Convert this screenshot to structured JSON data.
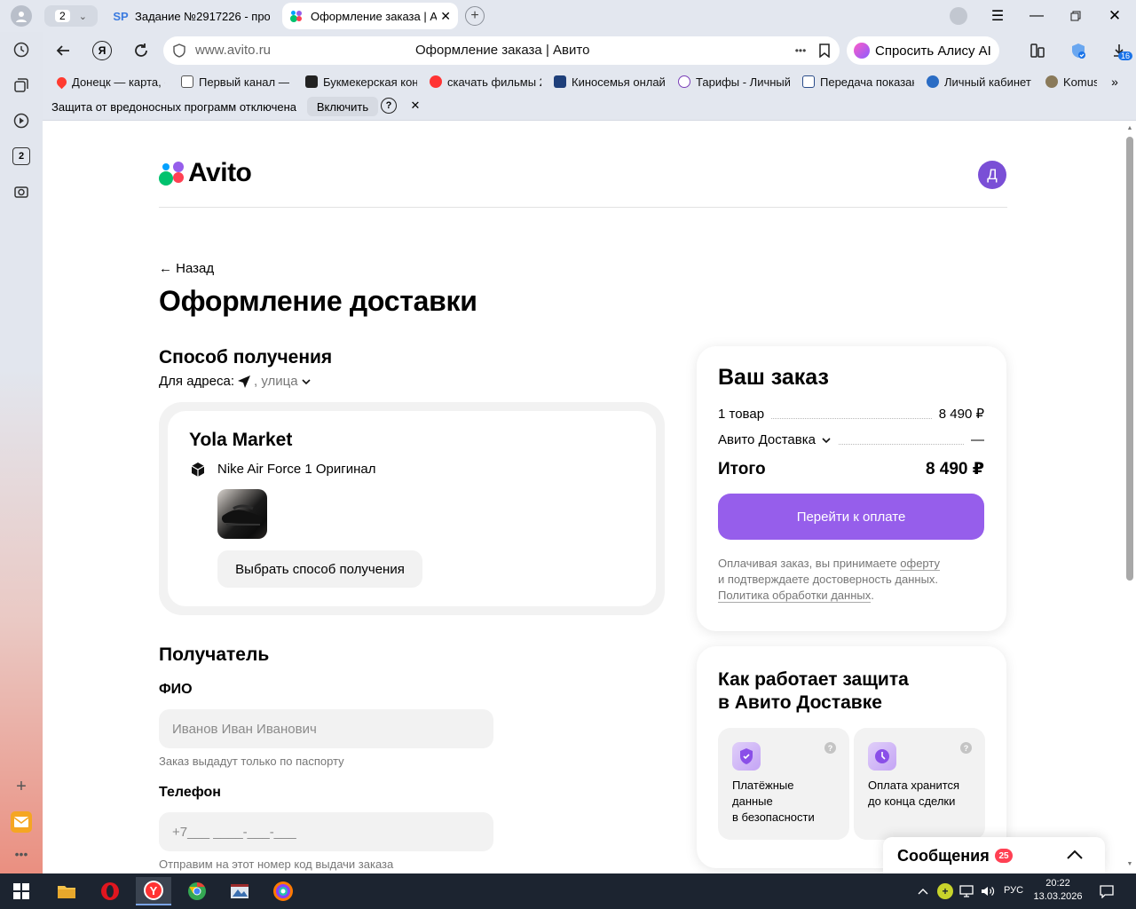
{
  "browser": {
    "tabs_counter": "2",
    "tabs": [
      {
        "label": "Задание №2917226 - про",
        "active": false
      },
      {
        "label": "Оформление заказа | Ави",
        "active": true
      }
    ],
    "url": "www.avito.ru",
    "page_title": "Оформление заказа | Авито",
    "alice_button": "Спросить Алису AI",
    "downloads_badge": "16",
    "side_counter": "2",
    "bookmarks": [
      "Донецк — карта, ф",
      "Первый канал — с",
      "Букмекерская кон",
      "скачать фильмы 2",
      "Киносемья онлайн",
      "Тарифы - Личный",
      "Передача показан",
      "Личный кабинет",
      "Komus"
    ],
    "infobar": {
      "text": "Защита от вредоносных программ отключена",
      "enable_button": "Включить",
      "help": "?",
      "close": "✕"
    }
  },
  "header": {
    "logo_text": "Avito",
    "avatar_letter": "Д"
  },
  "checkout": {
    "back_link": "← Назад",
    "title": "Оформление доставки",
    "delivery": {
      "heading": "Способ получения",
      "address_prefix": "Для адреса:",
      "address_value": ", улица"
    },
    "seller": {
      "name": "Yola Market",
      "product": "Nike Air Force 1 Оригинал",
      "choose_button": "Выбрать способ получения"
    },
    "recipient": {
      "heading": "Получатель",
      "name_label": "ФИО",
      "name_placeholder": "Иванов Иван Иванович",
      "name_hint": "Заказ выдадут только по паспорту",
      "phone_label": "Телефон",
      "phone_placeholder": "+7___ ____-___-___",
      "phone_hint": "Отправим на этот номер код выдачи заказа"
    }
  },
  "order_summary": {
    "heading": "Ваш заказ",
    "items_label": "1 товар",
    "items_price": "8 490 ₽",
    "delivery_label": "Авито Доставка",
    "delivery_price": "—",
    "total_label": "Итого",
    "total_price": "8 490 ₽",
    "pay_button": "Перейти к оплате",
    "legal_line1": "Оплачивая заказ, вы принимаете",
    "legal_offer_link": "оферту",
    "legal_line2": "и подтверждаете достоверность данных.",
    "legal_policy_link": "Политика обработки данных",
    "legal_dot": "."
  },
  "protection": {
    "heading_line1": "Как работает защита",
    "heading_line2": "в Авито Доставке",
    "cards": [
      {
        "line1": "Платёжные",
        "line2": "данные",
        "line3": "в безопасности"
      },
      {
        "line1": "Оплата хранится",
        "line2": "до конца сделки"
      }
    ]
  },
  "messages": {
    "label": "Сообщения",
    "count": "25"
  },
  "taskbar": {
    "language": "РУС",
    "time": "20:22",
    "date": "13.03.2026"
  },
  "colors": {
    "accent_purple": "#965eeb",
    "badge_red": "#ff4053",
    "avatar_purple": "#7a4fd6"
  }
}
